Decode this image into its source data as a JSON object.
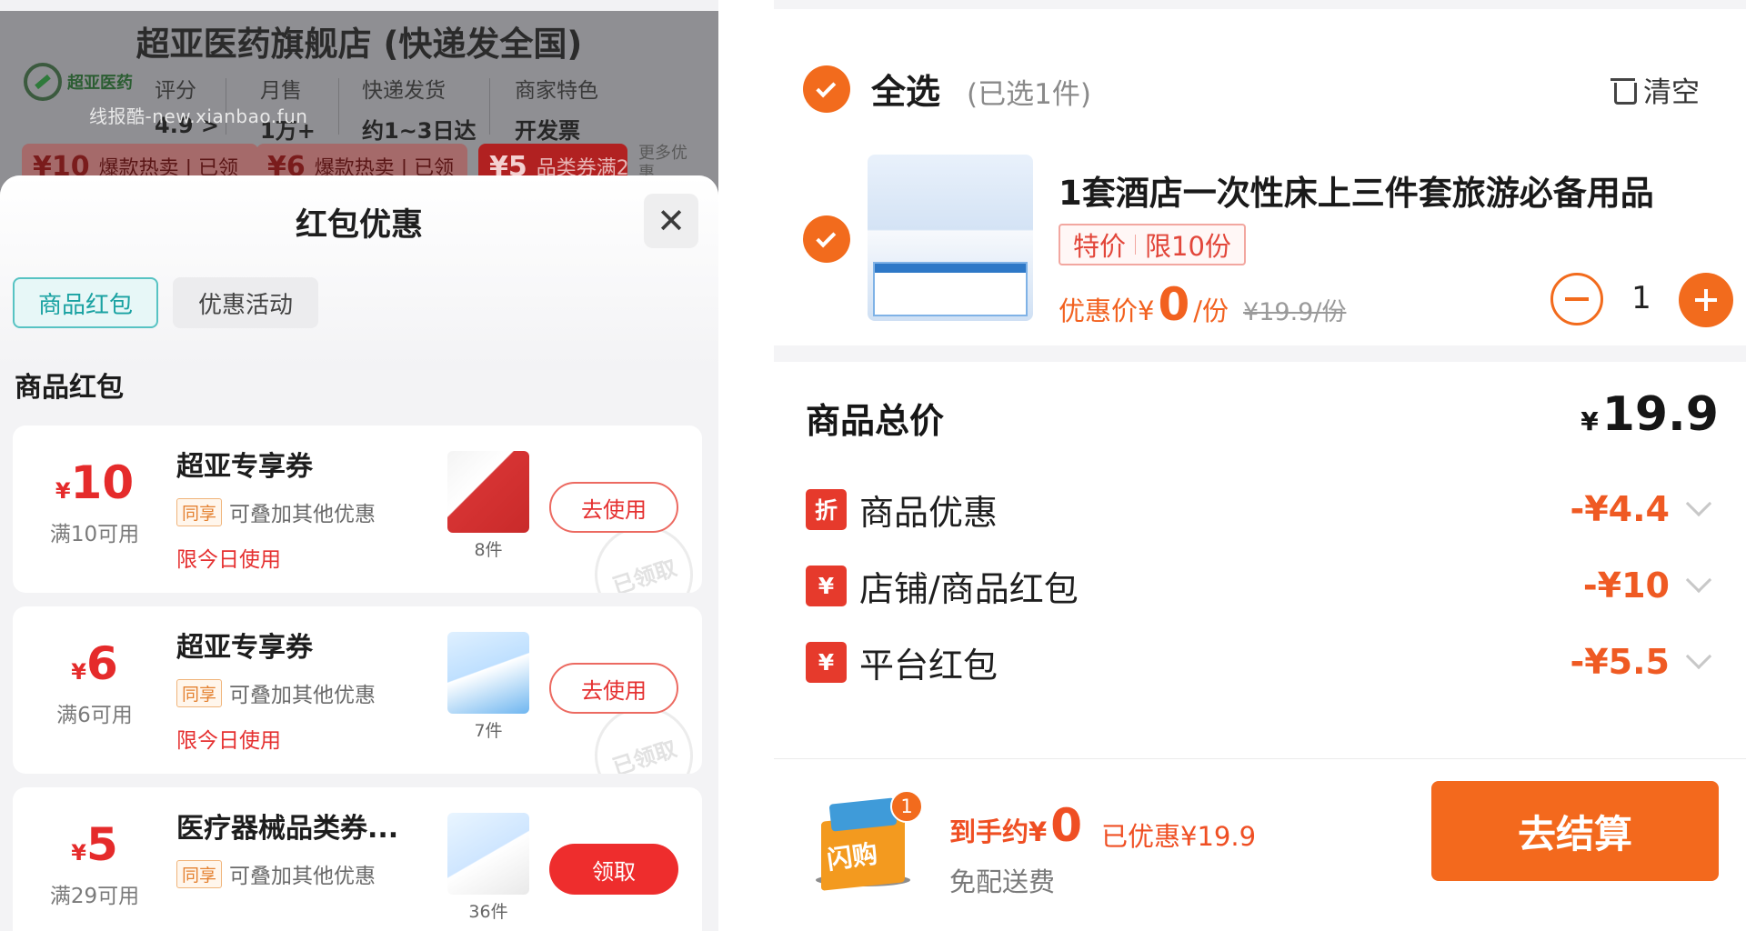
{
  "store": {
    "title": "超亚医药旗舰店 (快递发全国)",
    "logo_text": "超亚医药",
    "watermark": "线报酷-new.xianbao.fun",
    "stats": [
      {
        "label": "评分",
        "value": "4.9 >"
      },
      {
        "label": "月售",
        "value": "1万+"
      },
      {
        "label": "快递发货",
        "value": "约1~3日达"
      },
      {
        "label": "商家特色",
        "value": "开发票"
      }
    ],
    "coupon_strip": [
      {
        "amount": "¥10",
        "text": "爆款热卖 | 已领"
      },
      {
        "amount": "¥6",
        "text": "爆款热卖 | 已领"
      },
      {
        "amount": "¥5",
        "text": "品类券满2"
      }
    ],
    "more_label": "更多优惠"
  },
  "sheet": {
    "title": "红包优惠",
    "tabs": [
      "商品红包",
      "优惠活动"
    ],
    "section_label": "商品红包",
    "coupons": [
      {
        "symbol": "¥",
        "amount": "10",
        "condition": "满10可用",
        "name": "超亚专享券",
        "share_tag": "同享",
        "stack_text": "可叠加其他优惠",
        "limit": "限今日使用",
        "count": "8件",
        "button": "去使用",
        "stamp": "已领取"
      },
      {
        "symbol": "¥",
        "amount": "6",
        "condition": "满6可用",
        "name": "超亚专享券",
        "share_tag": "同享",
        "stack_text": "可叠加其他优惠",
        "limit": "限今日使用",
        "count": "7件",
        "button": "去使用",
        "stamp": "已领取"
      },
      {
        "symbol": "¥",
        "amount": "5",
        "condition": "满29可用",
        "name": "医疗器械品类券...",
        "share_tag": "同享",
        "stack_text": "可叠加其他优惠",
        "limit": "",
        "count": "36件",
        "button": "领取",
        "stamp": ""
      }
    ]
  },
  "cart": {
    "select_all": "全选",
    "selected_count": "(已选1件)",
    "clear_label": "清空",
    "product": {
      "title": "1套酒店一次性床上三件套旅游必备用品",
      "tag_special": "特价",
      "tag_limit": "限10份",
      "price_label": "优惠价¥",
      "price": "0",
      "price_unit": "/份",
      "original_price": "¥19.9/份",
      "quantity": "1"
    }
  },
  "summary": {
    "title": "商品总价",
    "total_symbol": "¥",
    "total": "19.9",
    "rows": [
      {
        "badge": "折",
        "label": "商品优惠",
        "value": "-¥4.4"
      },
      {
        "badge": "¥",
        "label": "店铺/商品红包",
        "value": "-¥10"
      },
      {
        "badge": "¥",
        "label": "平台红包",
        "value": "-¥5.5"
      }
    ]
  },
  "bottom": {
    "flash_label": "闪购",
    "flash_count": "1",
    "arrive_label": "到手约¥",
    "arrive_value": "0",
    "saved": "已优惠¥19.9",
    "free_shipping": "免配送费",
    "checkout": "去结算"
  },
  "colors": {
    "accent": "#f26b1d",
    "coupon_red": "#e52b2b",
    "tab_teal": "#1aa2a2"
  }
}
